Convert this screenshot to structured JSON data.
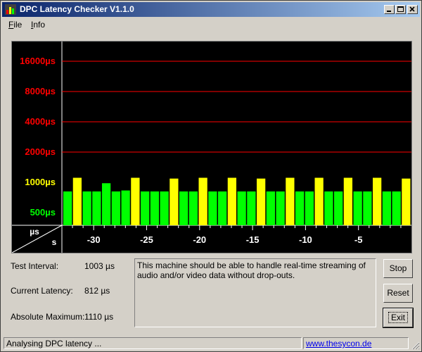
{
  "window": {
    "title": "DPC Latency Checker V1.1.0"
  },
  "menu": [
    {
      "label": "File",
      "underline": "F",
      "rest": "ile"
    },
    {
      "label": "Info",
      "underline": "I",
      "rest": "nfo"
    }
  ],
  "chart_data": {
    "type": "bar",
    "y_tick_labels": [
      {
        "label": "16000µs",
        "value": 16000,
        "color": "#ff0000"
      },
      {
        "label": "8000µs",
        "value": 8000,
        "color": "#ff0000"
      },
      {
        "label": "4000µs",
        "value": 4000,
        "color": "#ff0000"
      },
      {
        "label": "2000µs",
        "value": 2000,
        "color": "#ff0000"
      },
      {
        "label": "1000µs",
        "value": 1000,
        "color": "#ffff00"
      },
      {
        "label": "500µs",
        "value": 500,
        "color": "#00ff00"
      }
    ],
    "y_unit_label": "µs",
    "x_unit_label": "s",
    "x_tick_labels": [
      "-30",
      "-25",
      "-20",
      "-15",
      "-10",
      "-5"
    ],
    "x_ticks": [
      -30,
      -25,
      -20,
      -15,
      -10,
      -5
    ],
    "xlim": [
      -33,
      0
    ],
    "y_scale": "log2",
    "values": [
      812,
      1110,
      812,
      812,
      980,
      812,
      830,
      1110,
      812,
      812,
      812,
      1090,
      812,
      812,
      1110,
      812,
      812,
      1110,
      812,
      812,
      1090,
      812,
      812,
      1110,
      812,
      812,
      1110,
      812,
      812,
      1110,
      812,
      812,
      1110,
      812,
      812,
      1090
    ],
    "colors": {
      "green": "#00ff00",
      "yellow": "#ffff00",
      "red": "#ff0000"
    }
  },
  "info": {
    "test_interval_label": "Test Interval:",
    "test_interval_value": "1003 µs",
    "current_latency_label": "Current Latency:",
    "current_latency_value": "812 µs",
    "absolute_maximum_label": "Absolute Maximum:",
    "absolute_maximum_value": "1110 µs"
  },
  "message": "This machine should be able to handle real-time streaming of audio and/or video data without drop-outs.",
  "buttons": {
    "stop": "Stop",
    "reset": "Reset",
    "exit": "Exit"
  },
  "statusbar": {
    "status": "Analysing DPC latency ...",
    "link": "www.thesycon.de"
  }
}
